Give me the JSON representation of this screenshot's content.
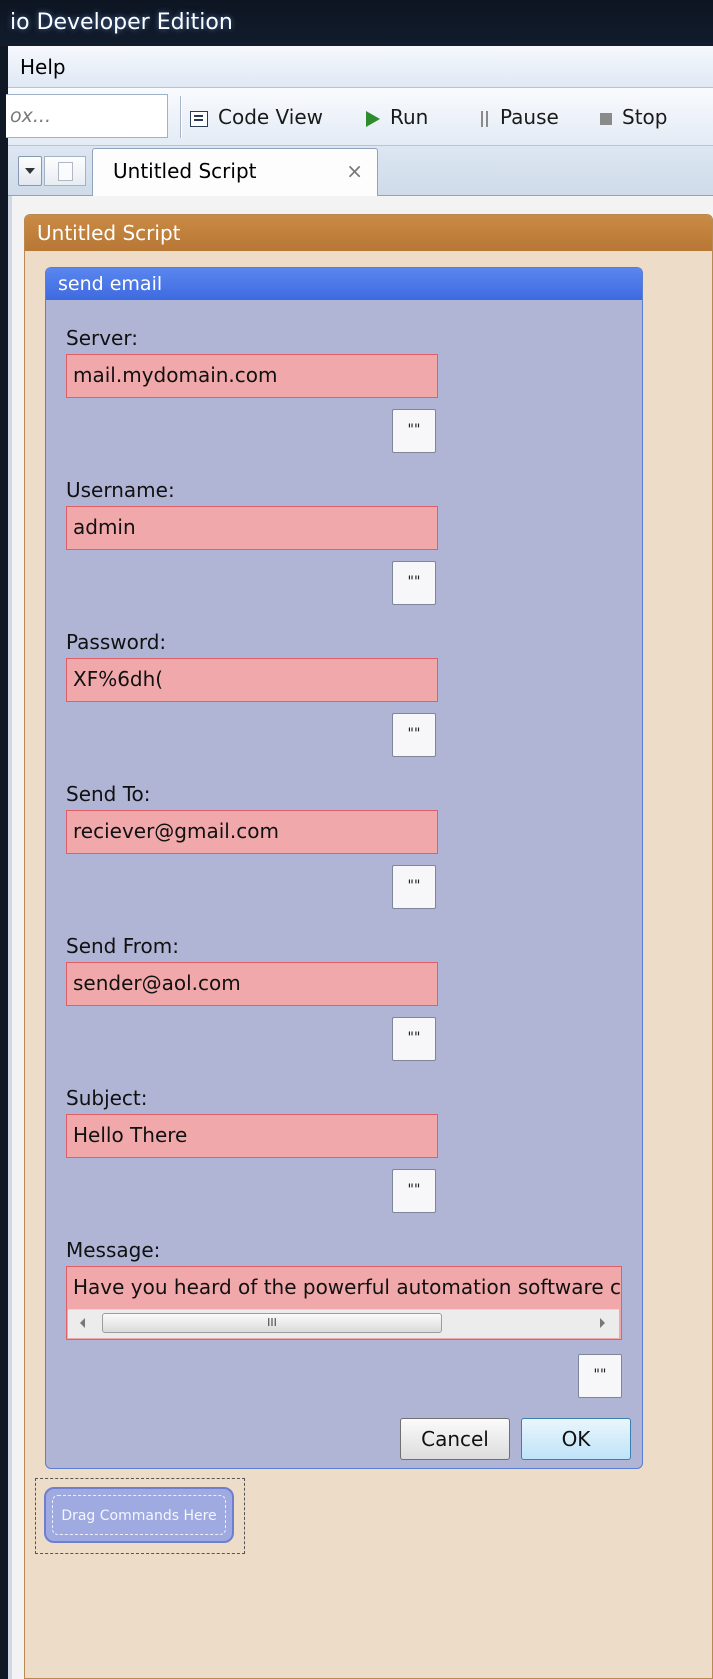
{
  "window": {
    "title": "io Developer Edition"
  },
  "menu": {
    "items": [
      {
        "label": "Help"
      }
    ]
  },
  "toolbar": {
    "search_placeholder": "ox...",
    "buttons": [
      {
        "label": "Code View",
        "icon": "code-view-icon"
      },
      {
        "label": "Run",
        "icon": "play-icon"
      },
      {
        "label": "Pause",
        "icon": "pause-icon"
      },
      {
        "label": "Stop",
        "icon": "stop-icon"
      }
    ]
  },
  "tabs": [
    {
      "label": "Untitled Script",
      "close": "×"
    }
  ],
  "script": {
    "title": "Untitled Script"
  },
  "command": {
    "title": "send email",
    "fields": [
      {
        "label": "Server:",
        "value": "mail.mydomain.com"
      },
      {
        "label": "Username:",
        "value": "admin"
      },
      {
        "label": "Password:",
        "value": "XF%6dh("
      },
      {
        "label": "Send To:",
        "value": "reciever@gmail.com"
      },
      {
        "label": "Send From:",
        "value": "sender@aol.com"
      },
      {
        "label": "Subject:",
        "value": "Hello There"
      }
    ],
    "message": {
      "label": "Message:",
      "value": "Have you heard of the powerful automation software ca"
    },
    "quote_button": "\"\"",
    "scroll_thumb": "III",
    "cancel_label": "Cancel",
    "ok_label": "OK"
  },
  "drag_zone": {
    "label": "Drag Commands Here"
  },
  "colors": {
    "script_header": "#b87735",
    "command_header": "#3e6ae0",
    "input_bg": "#f1a8aa",
    "input_border": "#e0606a",
    "command_bg": "#b0b5d6"
  }
}
